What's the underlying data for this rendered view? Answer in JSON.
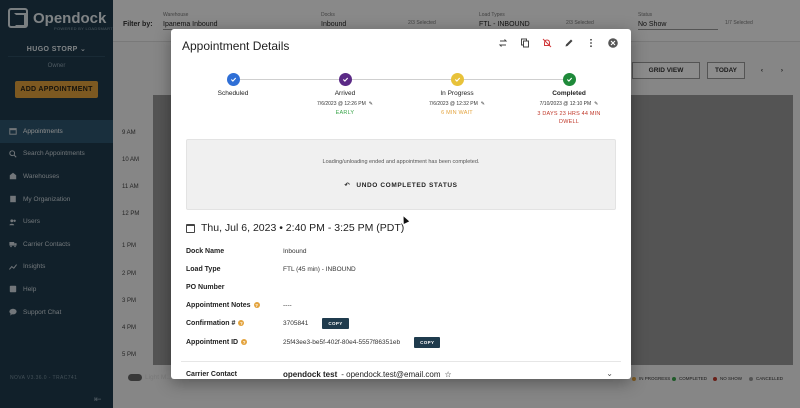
{
  "sidebar": {
    "logo": "Opendock",
    "logo_sub": "POWERED BY LOADSMART",
    "user_name": "HUGO STORP",
    "user_role": "Owner",
    "add_button": "ADD APPOINTMENT",
    "items": [
      {
        "label": "Appointments",
        "icon": "calendar-icon"
      },
      {
        "label": "Search Appointments",
        "icon": "search-icon"
      },
      {
        "label": "Warehouses",
        "icon": "warehouse-icon"
      },
      {
        "label": "My Organization",
        "icon": "organization-icon"
      },
      {
        "label": "Users",
        "icon": "users-icon"
      },
      {
        "label": "Carrier Contacts",
        "icon": "truck-icon"
      },
      {
        "label": "Insights",
        "icon": "chart-icon"
      },
      {
        "label": "Help",
        "icon": "help-icon"
      },
      {
        "label": "Support Chat",
        "icon": "chat-icon"
      }
    ],
    "version": "NOVA V3.36.0 - TRAC741"
  },
  "background": {
    "filter_by": "Filter by:",
    "filters": [
      {
        "label": "Warehouse",
        "value": "Ipanema Inbound"
      },
      {
        "label": "Docks",
        "value": "Inbound"
      },
      {
        "label": "",
        "value": "2/3 Selected"
      },
      {
        "label": "Load Types",
        "value": "FTL - INBOUND"
      },
      {
        "label": "",
        "value": "2/3 Selected"
      },
      {
        "label": "Status",
        "value": "No Show"
      },
      {
        "label": "",
        "value": "1/7 Selected"
      }
    ],
    "grid_view": "GRID VIEW",
    "today": "TODAY",
    "hours": [
      "9 AM",
      "10 AM",
      "11 AM",
      "12 PM",
      "1 PM",
      "2 PM",
      "3 PM",
      "4 PM",
      "5 PM"
    ],
    "legend": [
      {
        "label": "IN PROGRESS",
        "color": "#e3a33d"
      },
      {
        "label": "COMPLETED",
        "color": "#3aa54a"
      },
      {
        "label": "NO SHOW",
        "color": "#c0392b"
      },
      {
        "label": "CANCELLED",
        "color": "#999999"
      }
    ],
    "light_mode": "Light M..."
  },
  "modal": {
    "title": "Appointment Details",
    "icons": [
      "refresh-icon",
      "copy-icon",
      "notifications-off-icon",
      "edit-icon",
      "more-icon",
      "close-icon"
    ],
    "steps": [
      {
        "name": "Scheduled",
        "time": "",
        "note": "",
        "color": "#2f6fd6"
      },
      {
        "name": "Arrived",
        "time": "7/6/2023 @ 12:26 PM",
        "note": "EARLY",
        "color": "#5b2a86"
      },
      {
        "name": "In Progress",
        "time": "7/6/2023 @ 12:32 PM",
        "note": "6 MIN WAIT",
        "color": "#e8c23a"
      },
      {
        "name": "Completed",
        "time": "7/10/2023 @ 12:10 PM",
        "note": "3 DAYS 23 HRS 44 MIN DWELL",
        "color": "#1f8a3a"
      }
    ],
    "status_message": "Loading/unloading ended and appointment has been completed.",
    "undo_label": "UNDO COMPLETED STATUS",
    "date_line": "Thu, Jul 6, 2023 • 2:40 PM - 3:25 PM (PDT)",
    "details": [
      {
        "label": "Dock Name",
        "value": "Inbound"
      },
      {
        "label": "Load Type",
        "value": "FTL (45 min) - INBOUND"
      },
      {
        "label": "PO Number",
        "value": ""
      },
      {
        "label": "Appointment Notes",
        "value": "----"
      },
      {
        "label": "Confirmation #",
        "value": "3705841",
        "copy": "COPY"
      },
      {
        "label": "Appointment ID",
        "value": "25f43ee3-be5f-402f-80e4-5557f86351eb",
        "copy": "COPY"
      }
    ],
    "carrier_label": "Carrier Contact",
    "carrier_name": "opendock test",
    "carrier_email": "- opendock.test@email.com"
  }
}
